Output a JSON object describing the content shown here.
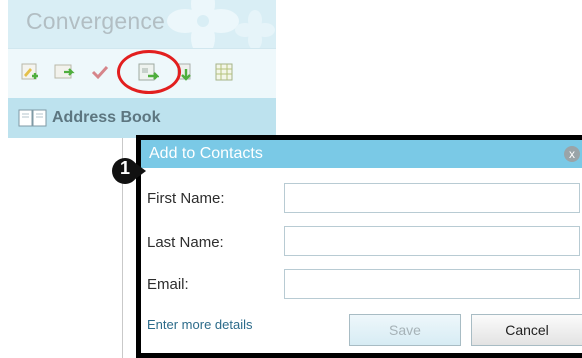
{
  "app": {
    "title": "Convergence"
  },
  "toolbar": {
    "buttons": [
      {
        "icon": "add-contact-icon"
      },
      {
        "icon": "edit-contact-icon"
      },
      {
        "icon": "check-icon"
      },
      {
        "icon": "add-to-contacts-icon",
        "highlighted": true
      },
      {
        "icon": "import-icon"
      },
      {
        "icon": "columns-icon"
      }
    ],
    "highlight_color": "#e21f1f"
  },
  "sidebar": {
    "address_book_label": "Address Book",
    "icon": "book-icon"
  },
  "dialog": {
    "title": "Add to Contacts",
    "close_glyph": "x",
    "fields": {
      "first_name_label": "First Name:",
      "last_name_label": "Last Name:",
      "email_label": "Email:"
    },
    "more_link": "Enter more details",
    "save_label": "Save",
    "cancel_label": "Cancel"
  },
  "step_marker": {
    "number": "1"
  },
  "colors": {
    "header_bg": "#d9eef5",
    "titlebar": "#7ac9e6",
    "link": "#2c6b8a"
  }
}
